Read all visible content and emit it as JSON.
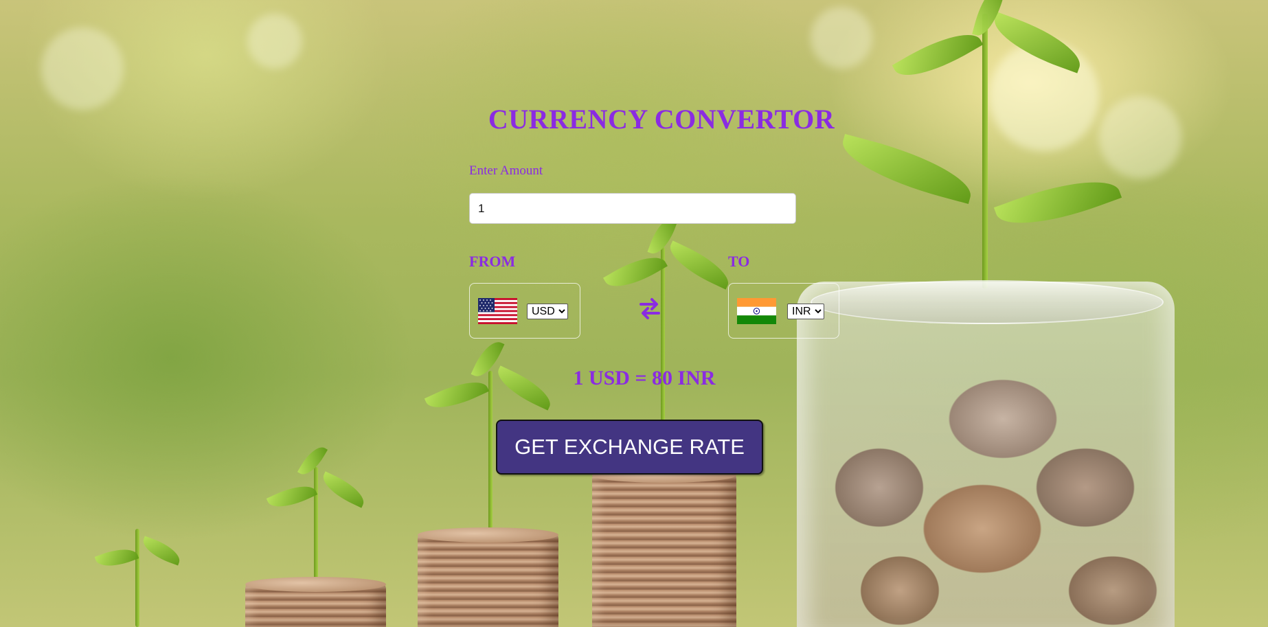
{
  "app": {
    "title": "CURRENCY CONVERTOR",
    "amount": {
      "label": "Enter Amount",
      "value": "1"
    },
    "from": {
      "label": "FROM",
      "flag_icon": "us-flag-icon",
      "selected": "USD",
      "options": [
        "USD"
      ]
    },
    "to": {
      "label": "TO",
      "flag_icon": "india-flag-icon",
      "selected": "INR",
      "options": [
        "INR"
      ]
    },
    "swap_icon": "swap-arrows-icon",
    "exchange_message": "1 USD = 80 INR",
    "button_label": "GET EXCHANGE RATE"
  },
  "colors": {
    "accent": "#8a2be2",
    "button_bg": "#433582",
    "button_text": "#ffffff"
  }
}
